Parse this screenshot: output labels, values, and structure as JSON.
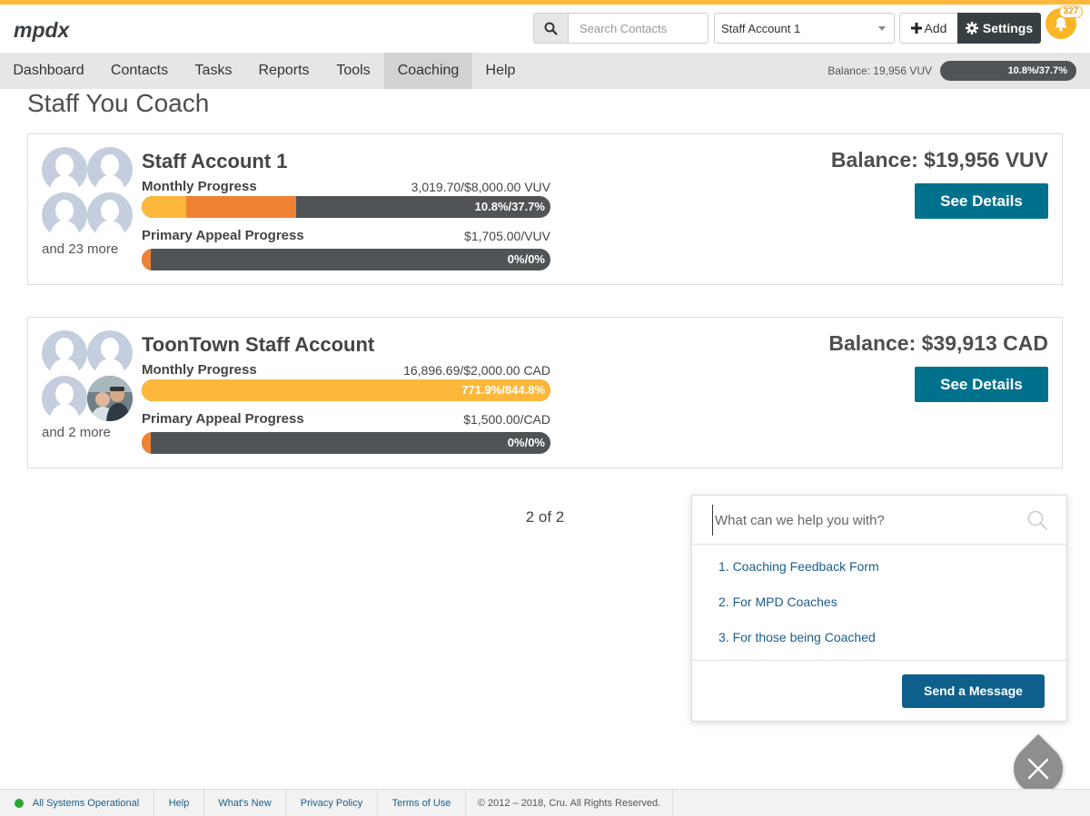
{
  "header": {
    "logo_text": "mpdx",
    "search_placeholder": "Search Contacts",
    "account_selected": "Staff Account 1",
    "add_label": "Add",
    "settings_label": "Settings",
    "notification_count": "327"
  },
  "nav": {
    "items": [
      "Dashboard",
      "Contacts",
      "Tasks",
      "Reports",
      "Tools",
      "Coaching",
      "Help"
    ],
    "active": "Coaching",
    "balance": "Balance: 19,956 VUV",
    "progress_label": "10.8%/37.7%",
    "progress_received": 0.108,
    "progress_pledged": 0.377
  },
  "page": {
    "title": "Staff You Coach"
  },
  "cards": [
    {
      "name": "Staff Account 1",
      "more_text": "and 23 more",
      "balance": "Balance: $19,956 VUV",
      "details_label": "See Details",
      "monthly_label": "Monthly Progress",
      "monthly_amount": "3,019.70/$8,000.00 VUV",
      "monthly_pct": "10.8%/37.7%",
      "monthly_received": 0.108,
      "monthly_pledged": 0.377,
      "appeal_label": "Primary Appeal Progress",
      "appeal_amount": "$1,705.00/VUV",
      "appeal_pct": "0%/0%"
    },
    {
      "name": "ToonTown Staff Account",
      "more_text": "and 2 more",
      "balance": "Balance: $39,913 CAD",
      "details_label": "See Details",
      "monthly_label": "Monthly Progress",
      "monthly_amount": "16,896.69/$2,000.00 CAD",
      "monthly_pct": "771.9%/844.8%",
      "monthly_received": 1.0,
      "monthly_pledged": 1.0,
      "appeal_label": "Primary Appeal Progress",
      "appeal_amount": "$1,500.00/CAD",
      "appeal_pct": "0%/0%"
    }
  ],
  "pager": "2 of 2",
  "help_widget": {
    "search_placeholder": "What can we help you with?",
    "links": [
      "1. Coaching Feedback Form",
      "2. For MPD Coaches",
      "3. For those being Coached"
    ],
    "send_label": "Send a Message"
  },
  "footer": {
    "status": "All Systems Operational",
    "links": [
      "Help",
      "What's New",
      "Privacy Policy",
      "Terms of Use"
    ],
    "copyright": "© 2012 – 2018, Cru. All Rights Reserved."
  },
  "colors": {
    "accent": "#fdb83b",
    "orange": "#ee8232",
    "teal_button": "#00718d",
    "dark_button": "#383f43"
  }
}
